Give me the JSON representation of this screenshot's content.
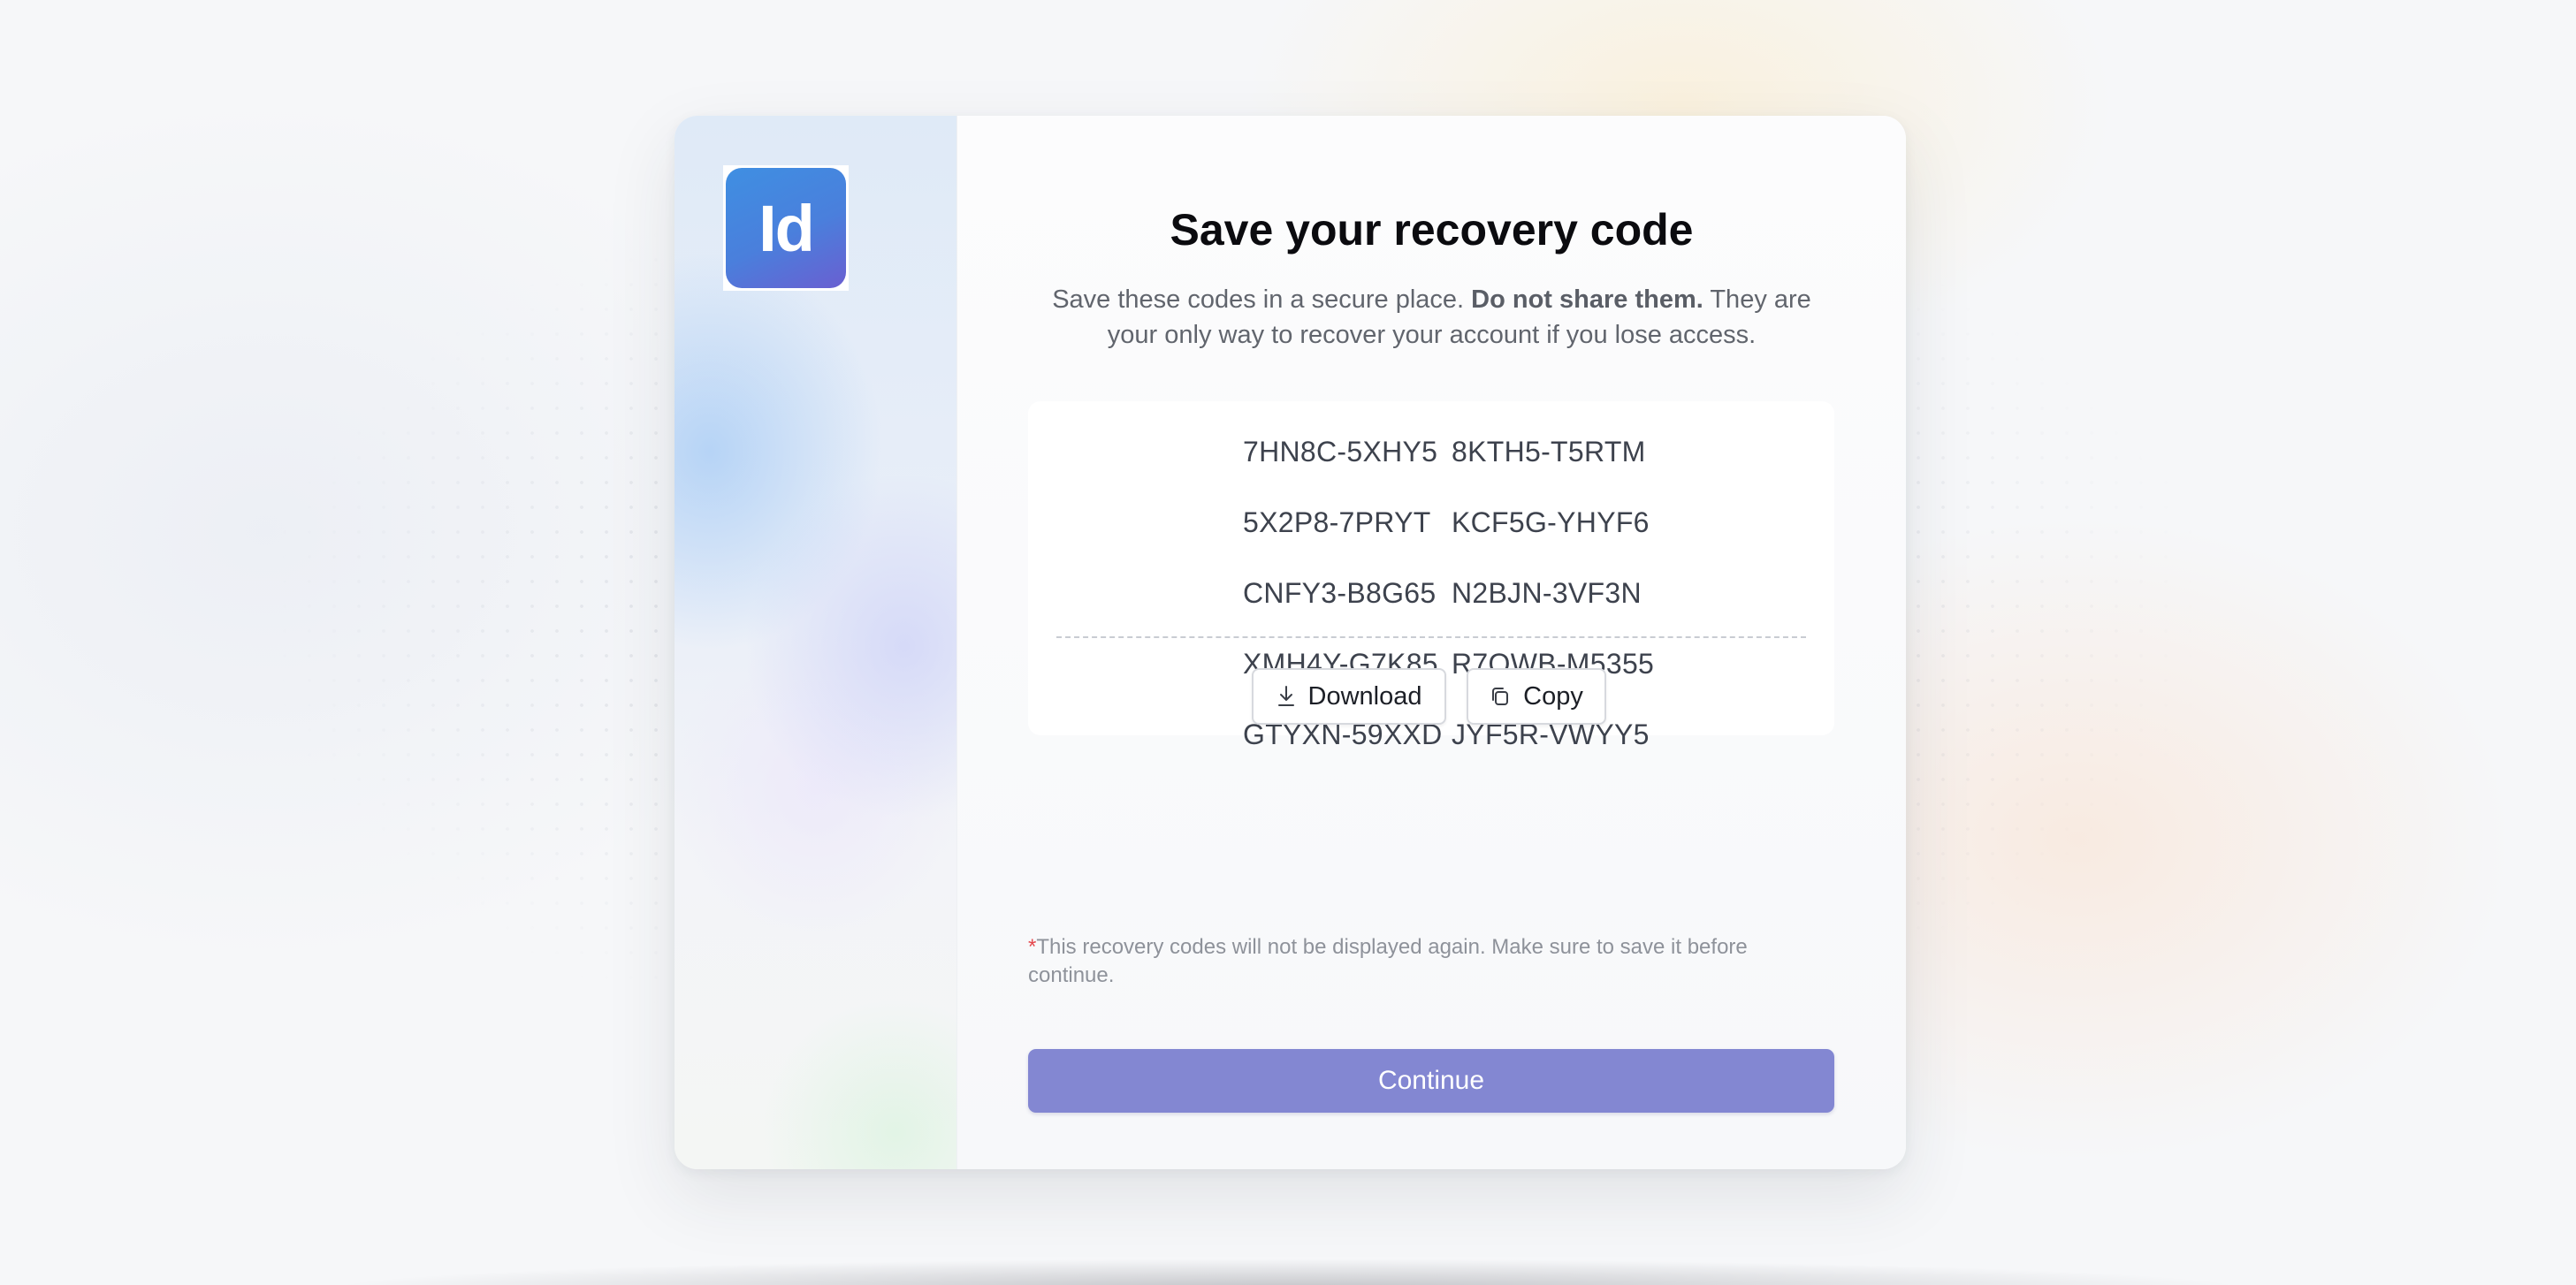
{
  "brand": {
    "logo_text": "Id",
    "logo_gradient": [
      "#3f8fe2",
      "#6a5fd1"
    ]
  },
  "dialog": {
    "title": "Save your recovery code",
    "subtitle_prefix": "Save these codes in a secure place. ",
    "subtitle_bold": "Do not share them.",
    "subtitle_suffix": " They are your only way to recover your account if you lose access.",
    "codes": [
      "7HN8C-5XHY5",
      "8KTH5-T5RTM",
      "5X2P8-7PRYT",
      "KCF5G-YHYF6",
      "CNFY3-B8G65",
      "N2BJN-3VF3N",
      "XMH4Y-G7K85",
      "R7QWB-M5355",
      "GTYXN-59XXD",
      "JYF5R-VWYY5"
    ],
    "download_label": "Download",
    "download_icon": "download-icon",
    "copy_label": "Copy",
    "copy_icon": "copy-icon",
    "note_star": "*",
    "note_line1": "This recovery codes will not be displayed again. Make sure to save it before",
    "note_line2": "continue.",
    "continue_label": "Continue"
  },
  "colors": {
    "primary_button": "#8387d2",
    "required_star": "#e5484d"
  }
}
